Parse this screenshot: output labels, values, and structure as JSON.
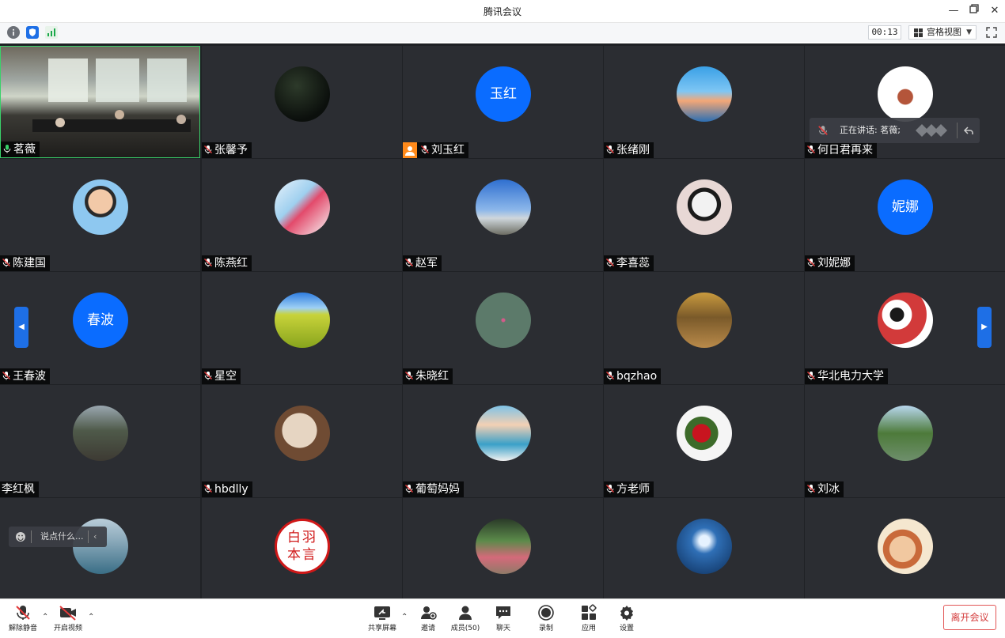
{
  "window": {
    "title": "腾讯会议"
  },
  "toolbar": {
    "timer": "00:13",
    "view_mode": "宫格视图"
  },
  "speaking": {
    "text": "正在讲话: 茗薇;"
  },
  "chat": {
    "placeholder": "说点什么..."
  },
  "participants": [
    {
      "name": "茗薇",
      "type": "video"
    },
    {
      "name": "张馨予",
      "type": "photo"
    },
    {
      "name": "刘玉红",
      "type": "text",
      "avatar_text": "玉红"
    },
    {
      "name": "张绪刚",
      "type": "photo"
    },
    {
      "name": "何日君再来",
      "type": "photo"
    },
    {
      "name": "陈建国",
      "type": "photo"
    },
    {
      "name": "陈燕红",
      "type": "photo"
    },
    {
      "name": "赵军",
      "type": "photo"
    },
    {
      "name": "李喜蕊",
      "type": "photo"
    },
    {
      "name": "刘妮娜",
      "type": "text",
      "avatar_text": "妮娜"
    },
    {
      "name": "王春波",
      "type": "text",
      "avatar_text": "春波"
    },
    {
      "name": "星空",
      "type": "photo"
    },
    {
      "name": "朱晓红",
      "type": "photo"
    },
    {
      "name": "bqzhao",
      "type": "photo"
    },
    {
      "name": "华北电力大学",
      "type": "photo"
    },
    {
      "name": "李红枫",
      "type": "photo"
    },
    {
      "name": "hbdlly",
      "type": "photo"
    },
    {
      "name": "葡萄妈妈",
      "type": "photo"
    },
    {
      "name": "方老师",
      "type": "photo"
    },
    {
      "name": "刘冰",
      "type": "photo"
    },
    {
      "name": "",
      "type": "photo"
    },
    {
      "name": "",
      "type": "photo",
      "stamp_text": "白羽本言"
    },
    {
      "name": "",
      "type": "photo"
    },
    {
      "name": "",
      "type": "photo"
    },
    {
      "name": "",
      "type": "photo"
    }
  ],
  "bottom": {
    "unmute": "解除静音",
    "start_video": "开启视频",
    "share_screen": "共享屏幕",
    "invite": "邀请",
    "members": "成员(50)",
    "chat": "聊天",
    "record": "录制",
    "apps": "应用",
    "settings": "设置",
    "leave": "离开会议"
  },
  "colors": {
    "accent": "#0a6cff",
    "danger": "#d43c3c",
    "grid_bg": "#2b2d32"
  }
}
